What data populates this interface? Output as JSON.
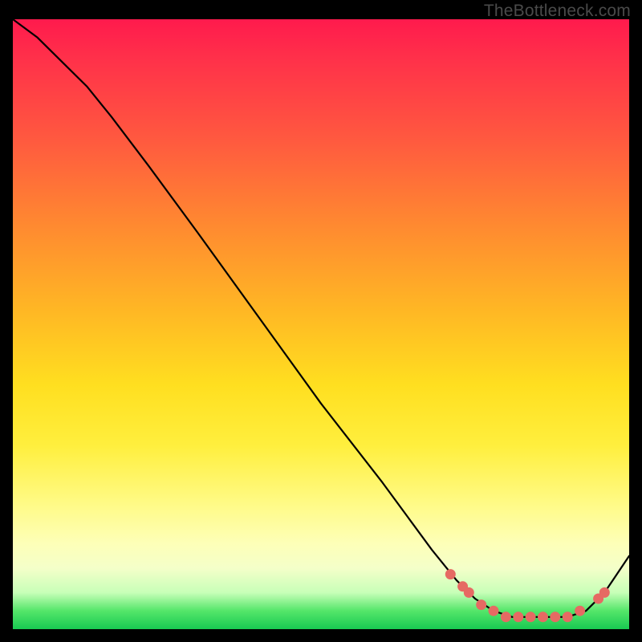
{
  "watermark": "TheBottleneck.com",
  "chart_data": {
    "type": "line",
    "title": "",
    "xlabel": "",
    "ylabel": "",
    "xlim": [
      0,
      100
    ],
    "ylim": [
      0,
      100
    ],
    "grid": false,
    "series": [
      {
        "name": "curve",
        "x": [
          0,
          4,
          8,
          12,
          16,
          22,
          30,
          40,
          50,
          60,
          68,
          72,
          75,
          78,
          81,
          84,
          87,
          90,
          93,
          96,
          100
        ],
        "y": [
          100,
          97,
          93,
          89,
          84,
          76,
          65,
          51,
          37,
          24,
          13,
          8,
          5,
          3,
          2,
          2,
          2,
          2,
          3,
          6,
          12
        ]
      }
    ],
    "points": [
      {
        "x": 71,
        "y": 9
      },
      {
        "x": 73,
        "y": 7
      },
      {
        "x": 74,
        "y": 6
      },
      {
        "x": 76,
        "y": 4
      },
      {
        "x": 78,
        "y": 3
      },
      {
        "x": 80,
        "y": 2
      },
      {
        "x": 82,
        "y": 2
      },
      {
        "x": 84,
        "y": 2
      },
      {
        "x": 86,
        "y": 2
      },
      {
        "x": 88,
        "y": 2
      },
      {
        "x": 90,
        "y": 2
      },
      {
        "x": 92,
        "y": 3
      },
      {
        "x": 95,
        "y": 5
      },
      {
        "x": 96,
        "y": 6
      }
    ]
  }
}
